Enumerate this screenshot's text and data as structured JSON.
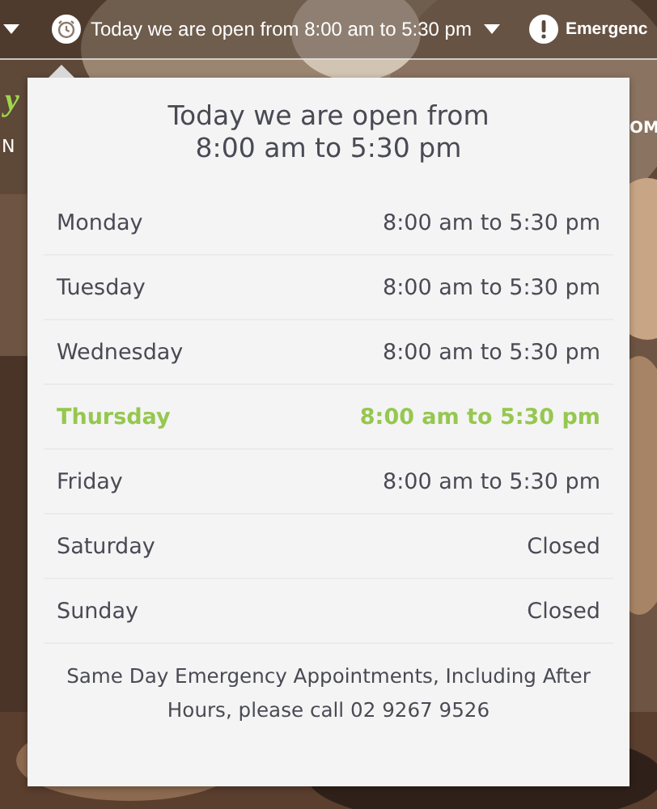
{
  "top_bar": {
    "hours_label": "Today we are open from 8:00 am to 5:30 pm",
    "emergency_label": "Emergenc"
  },
  "backdrop": {
    "kind": "picture",
    "logo": "y",
    "tagline": "N",
    "right_text": "OM"
  },
  "popup": {
    "title_lines": [
      "Today we are open from",
      "8:00 am to 5:30 pm"
    ],
    "days": [
      {
        "day": "Monday",
        "hours": "8:00 am to 5:30 pm",
        "selected": false
      },
      {
        "day": "Tuesday",
        "hours": "8:00 am to 5:30 pm",
        "selected": false
      },
      {
        "day": "Wednesday",
        "hours": "8:00 am to 5:30 pm",
        "selected": false
      },
      {
        "day": "Thursday",
        "hours": "8:00 am to 5:30 pm",
        "selected": true
      },
      {
        "day": "Friday",
        "hours": "8:00 am to 5:30 pm",
        "selected": false
      },
      {
        "day": "Saturday",
        "hours": "Closed",
        "selected": false
      },
      {
        "day": "Sunday",
        "hours": "Closed",
        "selected": false
      }
    ],
    "note": "Same Day Emergency Appointments, Including After Hours, please call 02 9267 9526"
  }
}
